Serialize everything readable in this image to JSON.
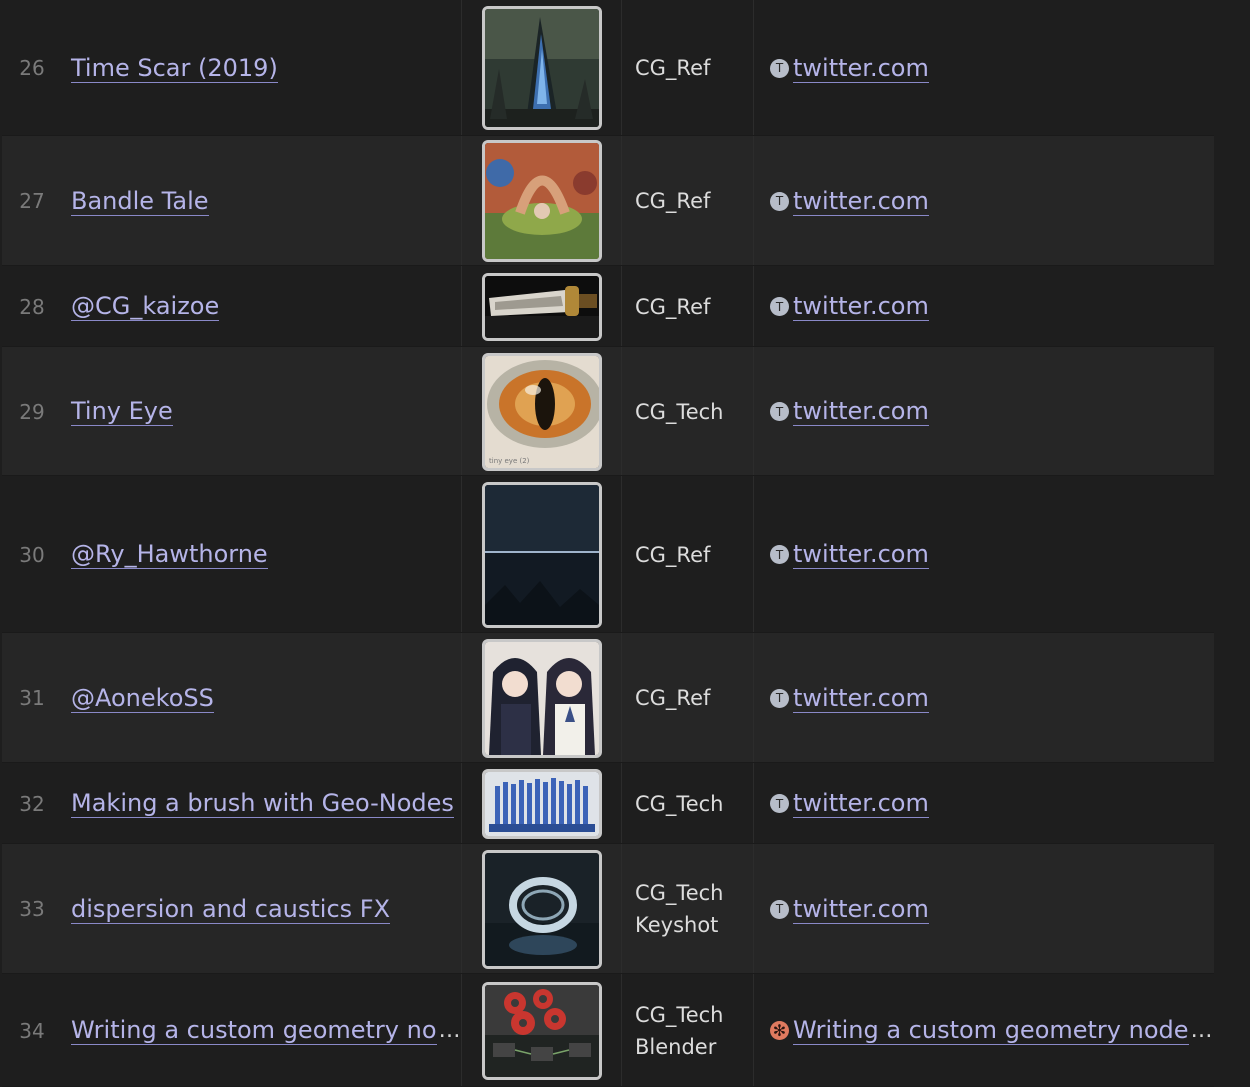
{
  "colors": {
    "link": "#b5b4e8",
    "row_alt": "#262626",
    "row_base": "#1e1e1e"
  },
  "rows": [
    {
      "num": "26",
      "title": "Time Scar (2019)",
      "thumb_icon": "dark-crystal-monolith-image",
      "tags": [
        "CG_Ref"
      ],
      "favicon": "T",
      "link": "twitter.com"
    },
    {
      "num": "27",
      "title": "Bandle Tale",
      "thumb_icon": "colorful-village-scene-image",
      "tags": [
        "CG_Ref"
      ],
      "favicon": "T",
      "link": "twitter.com"
    },
    {
      "num": "28",
      "title": "@CG_kaizoe",
      "thumb_icon": "ornate-sword-image",
      "tags": [
        "CG_Ref"
      ],
      "favicon": "T",
      "link": "twitter.com"
    },
    {
      "num": "29",
      "title": "Tiny Eye",
      "thumb_icon": "reptile-eye-image",
      "tags": [
        "CG_Tech"
      ],
      "favicon": "T",
      "link": "twitter.com",
      "thumb_caption": "tiny eye (2)"
    },
    {
      "num": "30",
      "title": "@Ry_Hawthorne",
      "thumb_icon": "dark-horizon-landscape-image",
      "tags": [
        "CG_Ref"
      ],
      "favicon": "T",
      "link": "twitter.com"
    },
    {
      "num": "31",
      "title": "@AonekoSS",
      "thumb_icon": "anime-girls-illustration-image",
      "tags": [
        "CG_Ref"
      ],
      "favicon": "T",
      "link": "twitter.com"
    },
    {
      "num": "32",
      "title": "Making a brush with Geo-Nodes",
      "thumb_icon": "blue-brush-bristles-image",
      "tags": [
        "CG_Tech"
      ],
      "favicon": "T",
      "link": "twitter.com"
    },
    {
      "num": "33",
      "title": "dispersion and caustics FX",
      "thumb_icon": "glass-ring-caustics-image",
      "tags": [
        "CG_Tech",
        "Keyshot"
      ],
      "favicon": "T",
      "link": "twitter.com"
    },
    {
      "num": "34",
      "title": "Writing a custom geometry no",
      "title_ellipsis": "…",
      "thumb_icon": "blender-node-editor-image",
      "tags": [
        "CG_Tech",
        "Blender"
      ],
      "favicon": "✻",
      "link": "Writing a custom geometry node ",
      "link_ellipsis": "…"
    }
  ]
}
